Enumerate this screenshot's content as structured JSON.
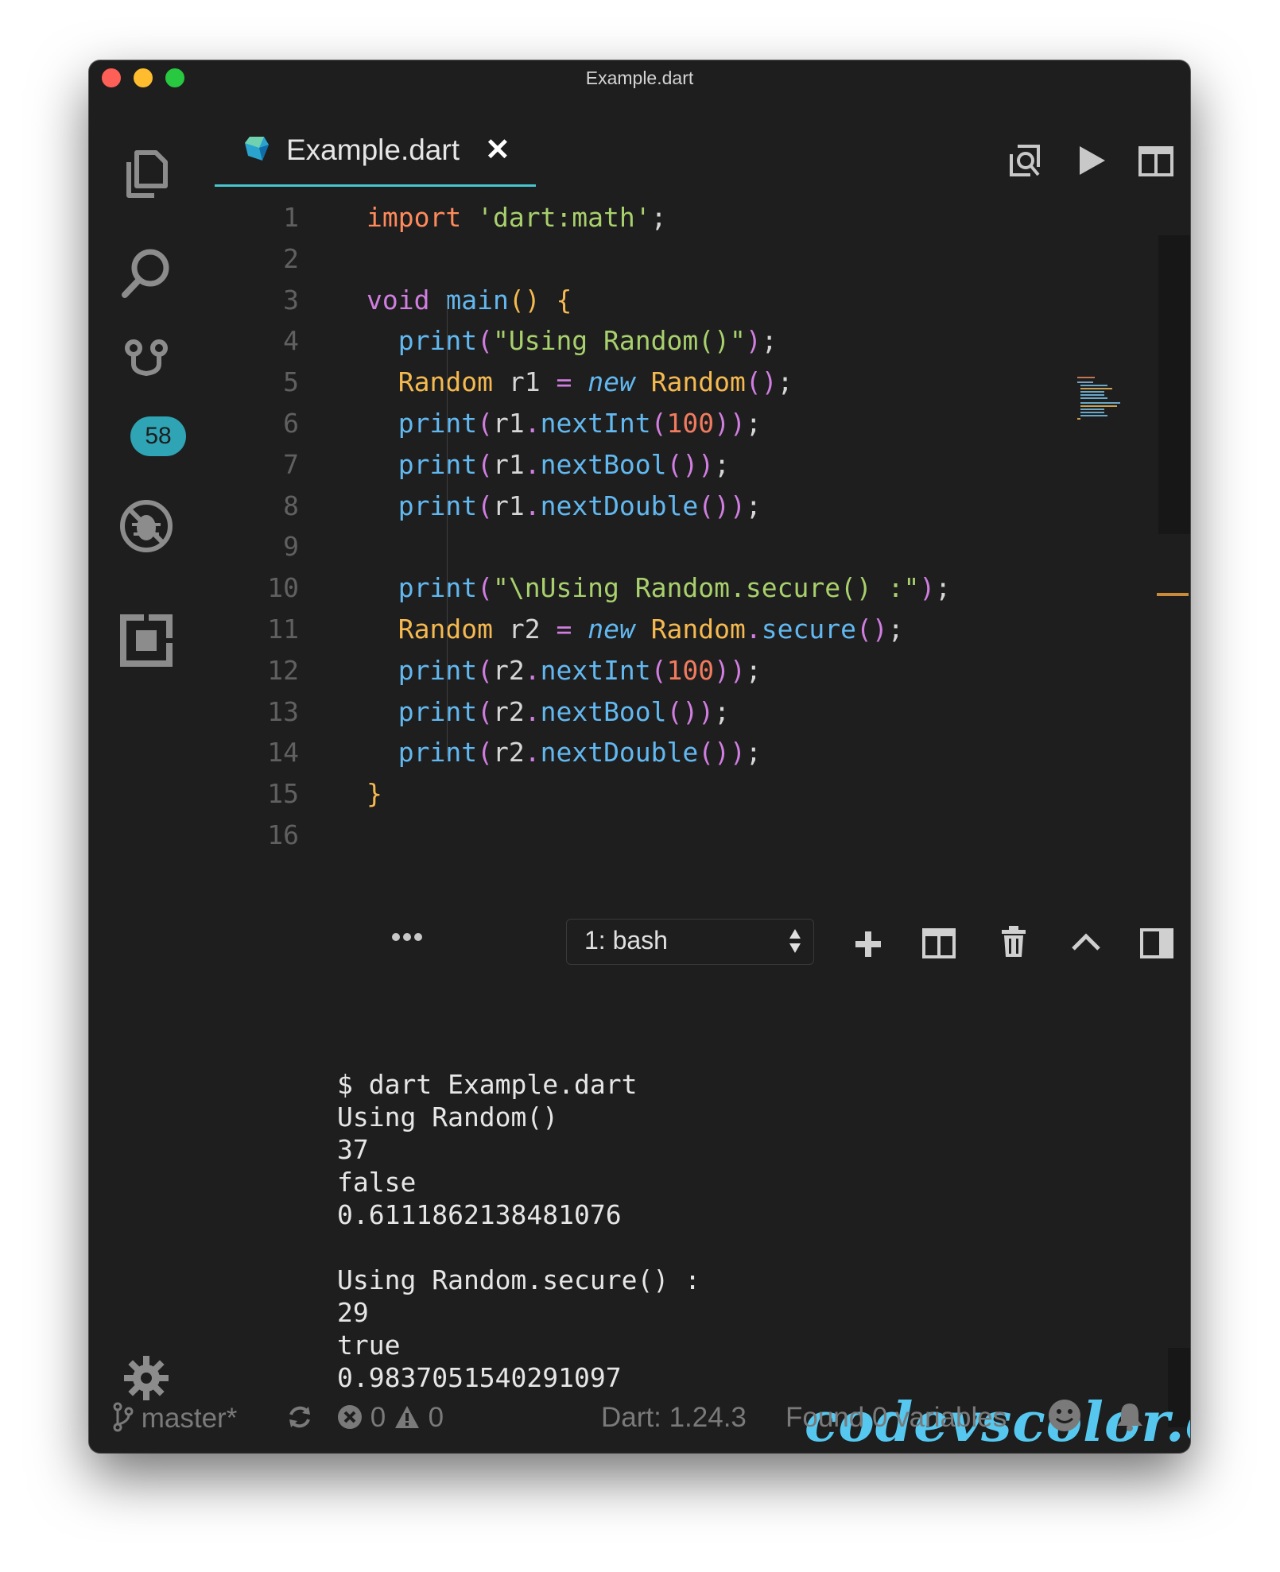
{
  "window": {
    "title": "Example.dart"
  },
  "activity_bar": {
    "scm_badge": "58"
  },
  "tab": {
    "label": "Example.dart"
  },
  "editor": {
    "lines": [
      {
        "n": "1",
        "tokens": [
          [
            "kw",
            "import"
          ],
          [
            "pun",
            " "
          ],
          [
            "str",
            "'dart:math'"
          ],
          [
            "pun",
            ";"
          ]
        ]
      },
      {
        "n": "2",
        "tokens": []
      },
      {
        "n": "3",
        "tokens": [
          [
            "paren",
            "void"
          ],
          [
            "pun",
            " "
          ],
          [
            "fn",
            "main"
          ],
          [
            "type",
            "()"
          ],
          [
            "pun",
            " "
          ],
          [
            "type",
            "{"
          ]
        ]
      },
      {
        "n": "4",
        "tokens": [
          [
            "pun",
            "  "
          ],
          [
            "fn",
            "print"
          ],
          [
            "paren",
            "("
          ],
          [
            "str",
            "\"Using Random()\""
          ],
          [
            "paren",
            ")"
          ],
          [
            "pun",
            ";"
          ]
        ]
      },
      {
        "n": "5",
        "tokens": [
          [
            "pun",
            "  "
          ],
          [
            "type",
            "Random"
          ],
          [
            "pun",
            " r1 "
          ],
          [
            "paren",
            "="
          ],
          [
            "pun",
            " "
          ],
          [
            "fn italic",
            "new"
          ],
          [
            "pun",
            " "
          ],
          [
            "type",
            "Random"
          ],
          [
            "paren",
            "()"
          ],
          [
            "pun",
            ";"
          ]
        ]
      },
      {
        "n": "6",
        "tokens": [
          [
            "pun",
            "  "
          ],
          [
            "fn",
            "print"
          ],
          [
            "paren",
            "("
          ],
          [
            "pun",
            "r1"
          ],
          [
            "paren",
            "."
          ],
          [
            "fn",
            "nextInt"
          ],
          [
            "paren",
            "("
          ],
          [
            "num",
            "100"
          ],
          [
            "paren",
            "))"
          ],
          [
            "pun",
            ";"
          ]
        ]
      },
      {
        "n": "7",
        "tokens": [
          [
            "pun",
            "  "
          ],
          [
            "fn",
            "print"
          ],
          [
            "paren",
            "("
          ],
          [
            "pun",
            "r1"
          ],
          [
            "paren",
            "."
          ],
          [
            "fn",
            "nextBool"
          ],
          [
            "paren",
            "())"
          ],
          [
            "pun",
            ";"
          ]
        ]
      },
      {
        "n": "8",
        "tokens": [
          [
            "pun",
            "  "
          ],
          [
            "fn",
            "print"
          ],
          [
            "paren",
            "("
          ],
          [
            "pun",
            "r1"
          ],
          [
            "paren",
            "."
          ],
          [
            "fn",
            "nextDouble"
          ],
          [
            "paren",
            "())"
          ],
          [
            "pun",
            ";"
          ]
        ]
      },
      {
        "n": "9",
        "tokens": []
      },
      {
        "n": "10",
        "tokens": [
          [
            "pun",
            "  "
          ],
          [
            "fn",
            "print"
          ],
          [
            "paren",
            "("
          ],
          [
            "str",
            "\"\\nUsing Random.secure() :\""
          ],
          [
            "paren",
            ")"
          ],
          [
            "pun",
            ";"
          ]
        ]
      },
      {
        "n": "11",
        "tokens": [
          [
            "pun",
            "  "
          ],
          [
            "type",
            "Random"
          ],
          [
            "pun",
            " r2 "
          ],
          [
            "paren",
            "="
          ],
          [
            "pun",
            " "
          ],
          [
            "fn italic",
            "new"
          ],
          [
            "pun",
            " "
          ],
          [
            "type",
            "Random"
          ],
          [
            "paren",
            "."
          ],
          [
            "fn",
            "secure"
          ],
          [
            "paren",
            "()"
          ],
          [
            "pun",
            ";"
          ]
        ]
      },
      {
        "n": "12",
        "tokens": [
          [
            "pun",
            "  "
          ],
          [
            "fn",
            "print"
          ],
          [
            "paren",
            "("
          ],
          [
            "pun",
            "r2"
          ],
          [
            "paren",
            "."
          ],
          [
            "fn",
            "nextInt"
          ],
          [
            "paren",
            "("
          ],
          [
            "num",
            "100"
          ],
          [
            "paren",
            "))"
          ],
          [
            "pun",
            ";"
          ]
        ]
      },
      {
        "n": "13",
        "tokens": [
          [
            "pun",
            "  "
          ],
          [
            "fn",
            "print"
          ],
          [
            "paren",
            "("
          ],
          [
            "pun",
            "r2"
          ],
          [
            "paren",
            "."
          ],
          [
            "fn",
            "nextBool"
          ],
          [
            "paren",
            "())"
          ],
          [
            "pun",
            ";"
          ]
        ]
      },
      {
        "n": "14",
        "tokens": [
          [
            "pun",
            "  "
          ],
          [
            "fn",
            "print"
          ],
          [
            "paren",
            "("
          ],
          [
            "pun",
            "r2"
          ],
          [
            "paren",
            "."
          ],
          [
            "fn",
            "nextDouble"
          ],
          [
            "paren",
            "())"
          ],
          [
            "pun",
            ";"
          ]
        ]
      },
      {
        "n": "15",
        "tokens": [
          [
            "type",
            "}"
          ]
        ]
      },
      {
        "n": "16",
        "tokens": []
      }
    ]
  },
  "panel": {
    "terminal_select": "1: bash"
  },
  "terminal": {
    "lines": [
      "$ dart Example.dart",
      "Using Random()",
      "37",
      "false",
      "0.6111862138481076",
      "",
      "Using Random.secure() :",
      "29",
      "true",
      "0.9837051540291097"
    ],
    "prompt": "$ "
  },
  "watermark": "codevscolor.com",
  "status_bar": {
    "branch": "master*",
    "errors": "0",
    "warnings": "0",
    "dart_version": "Dart: 1.24.3",
    "variables": "Found 0 variables"
  }
}
